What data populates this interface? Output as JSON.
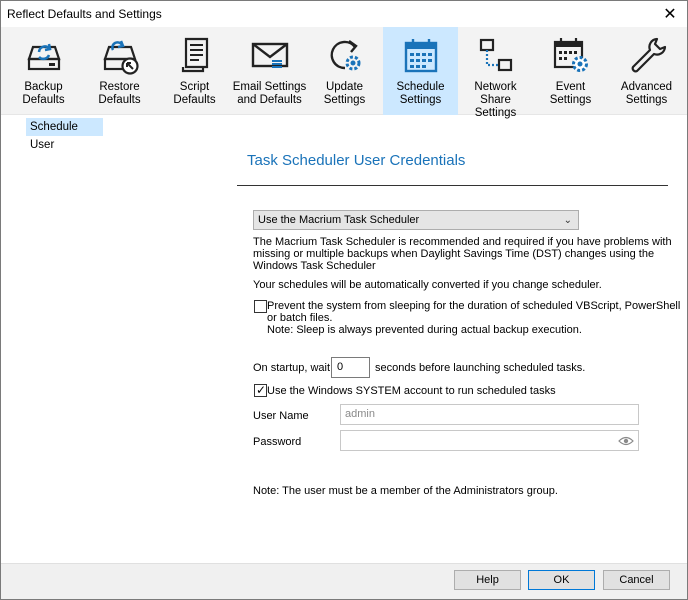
{
  "window": {
    "title": "Reflect Defaults and Settings",
    "close": "✕"
  },
  "toolbar": {
    "items": [
      {
        "label": "Backup\nDefaults",
        "icon": "backup-drive-icon"
      },
      {
        "label": "Restore\nDefaults",
        "icon": "restore-drive-icon"
      },
      {
        "label": "Script\nDefaults",
        "icon": "script-document-icon"
      },
      {
        "label": "Email Settings\nand Defaults",
        "icon": "email-icon"
      },
      {
        "label": "Update\nSettings",
        "icon": "update-gear-icon"
      },
      {
        "label": "Schedule\nSettings",
        "icon": "calendar-icon",
        "active": true
      },
      {
        "label": "Network Share\nSettings",
        "icon": "network-share-icon"
      },
      {
        "label": "Event\nSettings",
        "icon": "event-calendar-gear-icon"
      },
      {
        "label": "Advanced\nSettings",
        "icon": "wrench-icon"
      }
    ]
  },
  "left_tab": "Schedule User",
  "section": {
    "title": "Task Scheduler User Credentials"
  },
  "scheduler_select": {
    "value": "Use the Macrium Task Scheduler"
  },
  "info": {
    "line1": "The Macrium Task Scheduler is recommended and required if you have problems with",
    "line2": "missing or multiple backups when Daylight Savings Time (DST) changes using the",
    "line3": "Windows Task Scheduler",
    "converted": "Your schedules will be automatically converted if you change scheduler."
  },
  "prevent_sleep": {
    "checked": false,
    "line1": "Prevent the system from sleeping for the duration of scheduled VBScript, PowerShell",
    "line2": "or batch files.",
    "note": "Note: Sleep is always prevented during actual backup execution."
  },
  "startup": {
    "prefix": "On startup, wait",
    "value": "0",
    "suffix": "seconds before launching scheduled tasks."
  },
  "system_account": {
    "checked": true,
    "label": "Use the Windows SYSTEM account to run scheduled tasks"
  },
  "username": {
    "label": "User Name",
    "value": "admin"
  },
  "password": {
    "label": "Password",
    "value": ""
  },
  "admin_note": "Note: The user must be a member of the Administrators group.",
  "buttons": {
    "help": "Help",
    "ok": "OK",
    "cancel": "Cancel"
  },
  "colors": {
    "accent": "#1a73b9",
    "selected_bg": "#cce8ff",
    "toolbar_bg": "#f3f3f3"
  }
}
